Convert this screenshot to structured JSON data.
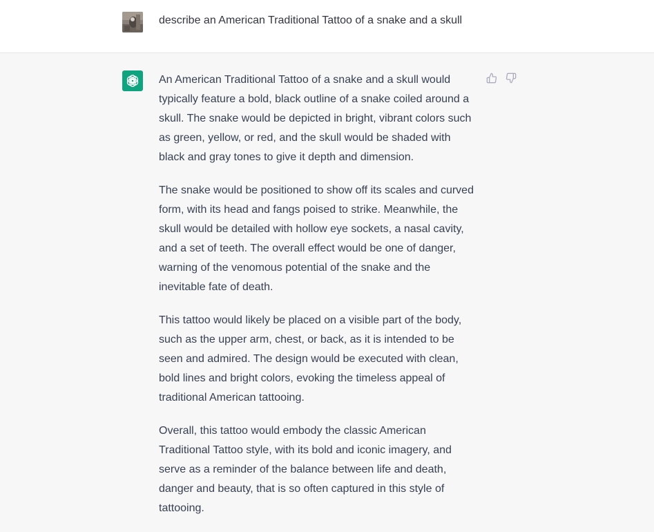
{
  "user_message": {
    "avatar_icon": "user-avatar-photo",
    "text": "describe an American Traditional Tattoo of a snake and a skull"
  },
  "assistant_message": {
    "avatar_icon": "openai-logo-icon",
    "brand_color": "#10a37f",
    "paragraphs": [
      "An American Traditional Tattoo of a snake and a skull would typically feature a bold, black outline of a snake coiled around a skull. The snake would be depicted in bright, vibrant colors such as green, yellow, or red, and the skull would be shaded with black and gray tones to give it depth and dimension.",
      "The snake would be positioned to show off its scales and curved form, with its head and fangs poised to strike. Meanwhile, the skull would be detailed with hollow eye sockets, a nasal cavity, and a set of teeth. The overall effect would be one of danger, warning of the venomous potential of the snake and the inevitable fate of death.",
      "This tattoo would likely be placed on a visible part of the body, such as the upper arm, chest, or back, as it is intended to be seen and admired. The design would be executed with clean, bold lines and bright colors, evoking the timeless appeal of traditional American tattooing.",
      "Overall, this tattoo would embody the classic American Traditional Tattoo style, with its bold and iconic imagery, and serve as a reminder of the balance between life and death, danger and beauty, that is so often captured in this style of tattooing."
    ],
    "feedback_icons": [
      "thumbs-up-icon",
      "thumbs-down-icon"
    ]
  }
}
